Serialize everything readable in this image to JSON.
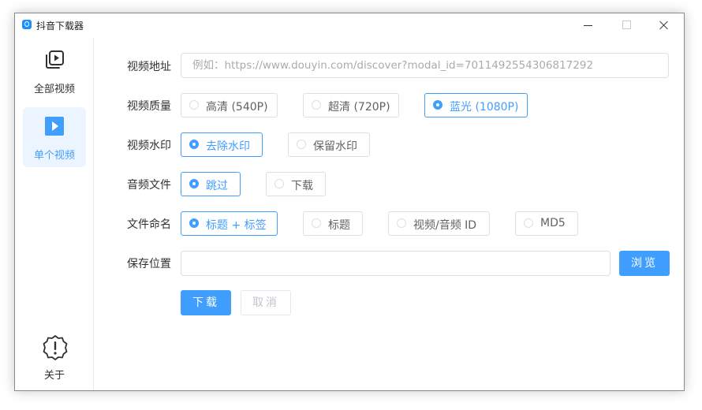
{
  "window": {
    "title": "抖音下载器"
  },
  "sidebar": {
    "items": [
      {
        "label": "全部视频",
        "active": false
      },
      {
        "label": "单个视频",
        "active": true
      }
    ],
    "about_label": "关于"
  },
  "form": {
    "url": {
      "label": "视频地址",
      "placeholder": "例如：https://www.douyin.com/discover?modal_id=7011492554306817292",
      "value": ""
    },
    "quality": {
      "label": "视频质量",
      "options": [
        "高清 (540P)",
        "超清 (720P)",
        "蓝光 (1080P)"
      ],
      "selected": "蓝光 (1080P)"
    },
    "watermark": {
      "label": "视频水印",
      "options": [
        "去除水印",
        "保留水印"
      ],
      "selected": "去除水印"
    },
    "audio": {
      "label": "音频文件",
      "options": [
        "跳过",
        "下载"
      ],
      "selected": "跳过"
    },
    "naming": {
      "label": "文件命名",
      "options": [
        "标题 + 标签",
        "标题",
        "视频/音频 ID",
        "MD5"
      ],
      "selected": "标题 + 标签"
    },
    "save": {
      "label": "保存位置",
      "value": "",
      "browse_label": "浏览"
    }
  },
  "actions": {
    "download_label": "下载",
    "cancel_label": "取消"
  },
  "colors": {
    "accent": "#409eff",
    "active_bg": "#ecf5ff",
    "border": "#dcdfe6"
  }
}
